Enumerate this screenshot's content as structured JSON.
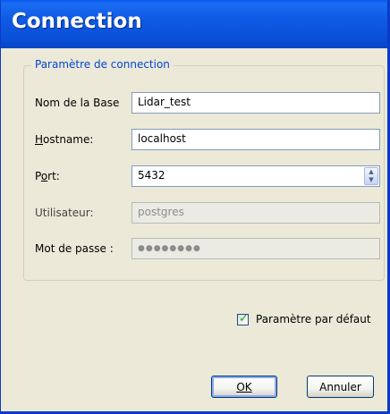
{
  "window": {
    "title": "Connection"
  },
  "group": {
    "legend": "Paramètre de connection"
  },
  "fields": {
    "database": {
      "label": "Nom de la Base",
      "value": "Lidar_test"
    },
    "hostname": {
      "label": "Hostname:",
      "value": "localhost"
    },
    "port": {
      "label": "Port:",
      "value": "5432"
    },
    "user": {
      "label": "Utilisateur:",
      "value": "postgres"
    },
    "password": {
      "label": "Mot de passe :",
      "value": "●●●●●●●●"
    }
  },
  "default_params": {
    "label": "Paramètre par défaut",
    "checked": true
  },
  "buttons": {
    "ok": "OK",
    "cancel": "Annuler"
  }
}
